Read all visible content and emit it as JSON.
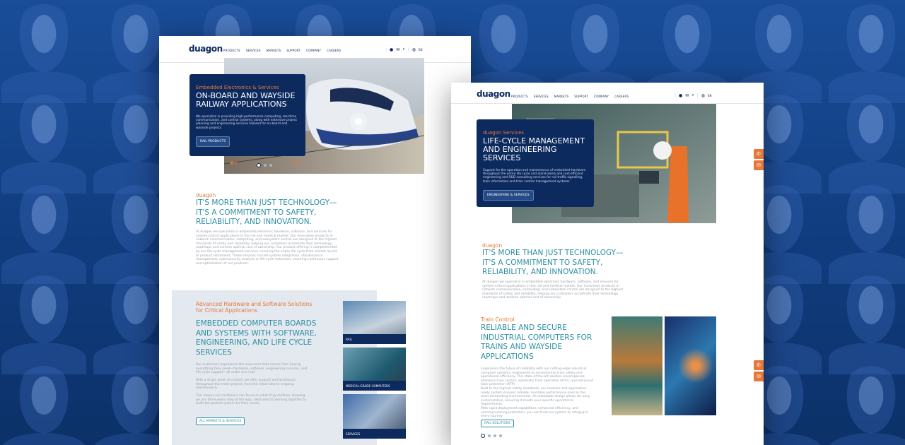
{
  "left_page": {
    "logo": "duagon",
    "nav": [
      "PRODUCTS",
      "SERVICES",
      "MARKETS",
      "SUPPORT",
      "COMPANY",
      "CAREERS"
    ],
    "lang": "EN",
    "hero": {
      "kicker": "Embedded Electronics & Services",
      "heading": "ON-BOARD AND WAYSIDE RAILWAY APPLICATIONS",
      "text": "We specialize in providing high-performance computing, real-time communication, and control systems, along with extensive project planning and engineering services tailored for on-board and wayside projects.",
      "button": "RAIL PRODUCTS"
    },
    "intro": {
      "kicker": "duagon",
      "heading": "IT'S MORE THAN JUST TECHNOLOGY—IT'S A COMMITMENT TO SAFETY, RELIABILITY, AND INNOVATION.",
      "text": "At duagon we specialize in embedded electronic hardware, software, and services for system-critical applications in the rail and medical market. Our innovative products in network communication, computing, and subsystem control are designed to the highest standards of safety and reliability, helping our customers accelerate their technology roadmaps and achieve optimal cost of ownership. Our product offering is complemented by our life-cycle management services, covering the entire life cycle from market launch to product retirement. These services include system integration, obsolescence management, cybersecurity analysis or life-cycle extension, ensuring continuous support and optimization of our products."
    },
    "solutions": {
      "kicker": "Advanced Hardware and Software Solutions for Critical Applications",
      "heading": "EMBEDDED COMPUTER BOARDS AND SYSTEMS WITH SOFTWARE, ENGINEERING, AND LIFE CYCLE SERVICES",
      "p1": "Our customers experience the assurance that comes from having everything they need—hardware, software, engineering services, and life cycle support—all under one roof.",
      "p2": "With a single point of contact, we offer support and assistance throughout the entire project, from the initial idea to ongoing maintenance.",
      "p3": "This means our customers can focus on what truly matters, knowing we are there every step of the way, dedicated to working together to build the perfect system for their needs.",
      "button": "ALL MARKETS & SERVICES",
      "tiles": [
        "RAIL",
        "MEDICAL-GRADE COMPUTERS",
        "SERVICES"
      ]
    }
  },
  "right_page": {
    "logo": "duagon",
    "nav": [
      "PRODUCTS",
      "SERVICES",
      "MARKETS",
      "SUPPORT",
      "COMPANY",
      "CAREERS"
    ],
    "lang": "EN",
    "hero": {
      "kicker": "duagon Services",
      "heading": "LIFE-CYCLE MANAGEMENT AND ENGINEERING SERVICES",
      "text": "Support for the operation and maintenance of embedded hardware throughout the entire life cycle and stand-alone and cost-efficient engineering and R&D consulting services for rail traffic signalling, train information and train control management systems",
      "button": "ENGINEERING & SERVICES"
    },
    "intro": {
      "kicker": "duagon",
      "heading": "IT'S MORE THAN JUST TECHNOLOGY—IT'S A COMMITMENT TO SAFETY, RELIABILITY, AND INNOVATION.",
      "text": "At duagon we specialize in embedded electronic hardware, software, and services for system-critical applications in the rail and medical market. Our innovative products in network communication, computing, and subsystem control are designed to the highest standards of safety and reliability, helping our customers accelerate their technology roadmaps and achieve optimal cost of ownership."
    },
    "train": {
      "kicker": "Train Control",
      "heading": "RELIABLE AND SECURE INDUSTRIAL COMPUTERS FOR TRAINS AND WAYSIDE APPLICATIONS",
      "p1": "Experience the future of reliability with our cutting-edge industrial computer systems, engineered to revolutionize train safety and operational efficiency. This state-of-the-art solution encompasses seamless train control, automatic train operation (ATO), and advanced train protection (ATP).",
      "p2": "Built to the highest safety standards, our modular and application-ready system ensures reliable, real-time performance even in the most demanding environments. Its adaptable design allows for easy customization, ensuring it meets your specific operational requirements.",
      "p3": "With rapid deployment capabilities, enhanced efficiency, and uncompromising protection, you can trust our system to safeguard every journey.",
      "button": "RAIL SOLUTIONS"
    }
  }
}
